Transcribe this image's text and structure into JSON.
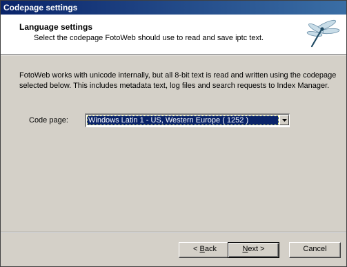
{
  "window": {
    "title": "Codepage settings"
  },
  "header": {
    "title": "Language settings",
    "subtitle": "Select the codepage FotoWeb should use to read and save iptc text.",
    "logo_icon": "dragonfly-icon"
  },
  "body": {
    "description": "FotoWeb works with unicode internally, but all 8-bit text is read and written using the codepage selected below. This includes metadata text, log files and search requests to Index Manager.",
    "codepage_label": "Code page:",
    "codepage_value": "Windows Latin 1 - US, Western Europe ( 1252 )"
  },
  "buttons": {
    "back_prefix": "< ",
    "back_mnemonic": "B",
    "back_rest": "ack",
    "next_mnemonic": "N",
    "next_rest": "ext >",
    "cancel_label": "Cancel"
  },
  "colors": {
    "titlebar": "#0a246a",
    "selection": "#0a246a",
    "dialog": "#d4d0c8"
  }
}
